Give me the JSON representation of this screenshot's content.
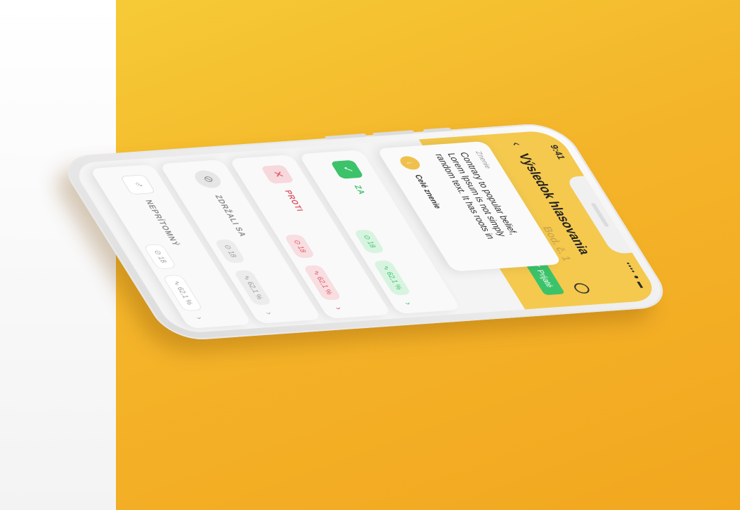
{
  "status": {
    "time": "9:41",
    "signal": "•••• ● ▬"
  },
  "header": {
    "back_icon": "‹",
    "title": "Výsledok hlasovania",
    "subtitle": "Bod. č. 1",
    "exit_icon": "logout-icon",
    "accepted": "✓ Prijaté"
  },
  "text_card": {
    "label": "Znenie",
    "body": "Contrary to popular belief, Lorem Ipsum is not simply random text. It has roots in",
    "expand_icon": "↓",
    "expand_label": "Celé znenie"
  },
  "rows": [
    {
      "icon": "✓",
      "label": "ZA",
      "count": "",
      "pct": "",
      "chev": ""
    },
    {
      "icon": "✕",
      "label": "PROTI",
      "count": "⊙ 18",
      "pct": "∿ 62,1 %",
      "chev": "›"
    },
    {
      "icon": "⊘",
      "label": "ZDRŽALI SA",
      "count": "⊙ 18",
      "pct": "∿ 62,1 %",
      "chev": "›"
    },
    {
      "icon": "♂",
      "label": "NEPRÍTOMNÝ",
      "count": "⊙ 18",
      "pct": "∿ 62,1 %",
      "chev": "›"
    }
  ],
  "extra_pills": {
    "count": "⊙ 18",
    "pct": "∿ 62,1 %",
    "chev": "›"
  }
}
